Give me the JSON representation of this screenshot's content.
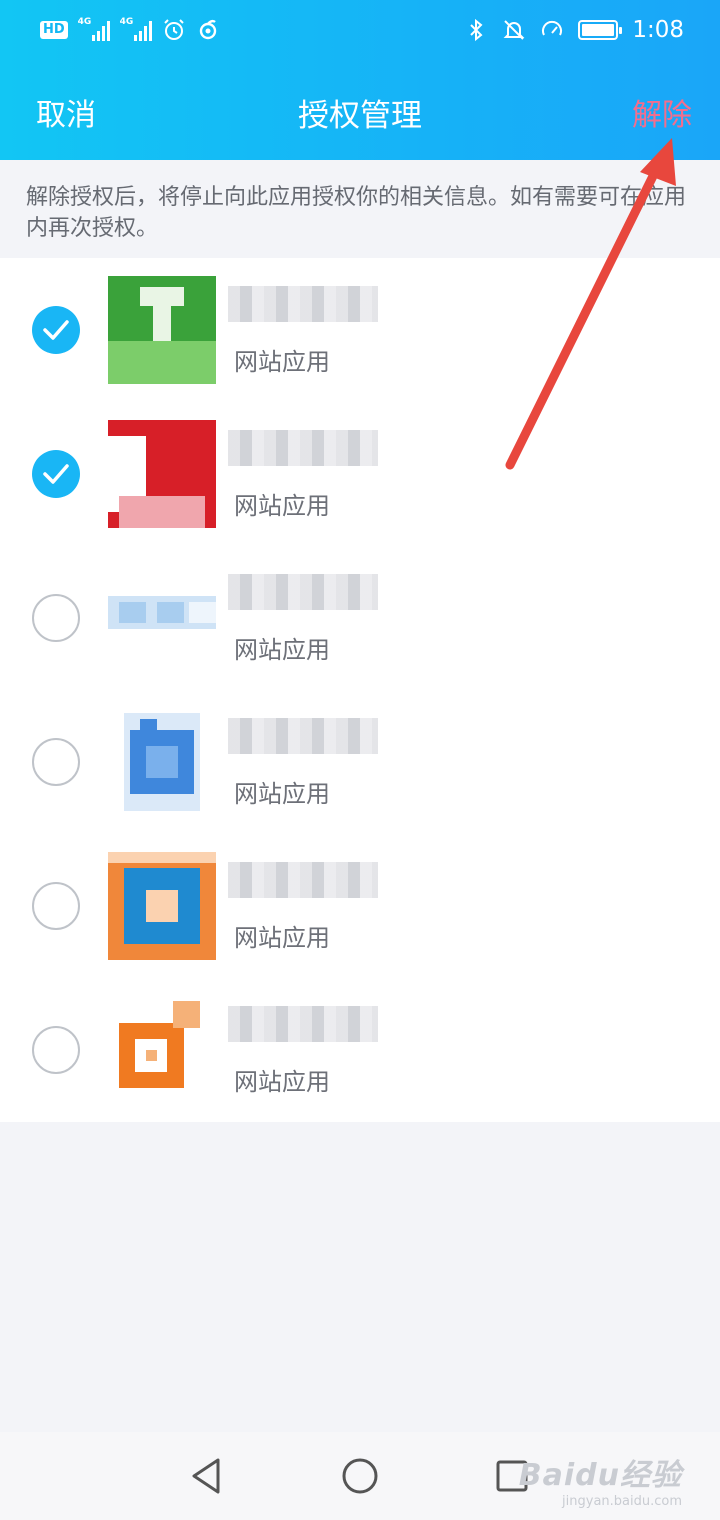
{
  "status_bar": {
    "hd_label": "HD",
    "network_label_1": "4G",
    "network_label_2": "4G",
    "time": "1:08"
  },
  "nav": {
    "cancel_label": "取消",
    "title": "授权管理",
    "remove_label": "解除",
    "remove_color": "#f26e8e"
  },
  "notice": "解除授权后，将停止向此应用授权你的相关信息。如有需要可在应用内再次授权。",
  "apps": [
    {
      "type": "网站应用",
      "checked": true,
      "icon": "green-t-app-icon",
      "colors": [
        "#3aa23a",
        "#7ccd6a",
        "#e9f5e5"
      ]
    },
    {
      "type": "网站应用",
      "checked": true,
      "icon": "red-app-icon",
      "colors": [
        "#d71f28",
        "#f0a6ad",
        "#ffffff"
      ]
    },
    {
      "type": "网站应用",
      "checked": false,
      "icon": "light-blue-app-icon",
      "colors": [
        "#cfe3f6",
        "#a8cdef",
        "#eef5fc"
      ]
    },
    {
      "type": "网站应用",
      "checked": false,
      "icon": "blue-paw-app-icon",
      "colors": [
        "#3f87dc",
        "#7ab0ec",
        "#dbe9f8"
      ]
    },
    {
      "type": "网站应用",
      "checked": false,
      "icon": "orange-blue-app-icon",
      "colors": [
        "#f0873a",
        "#1f8ad0",
        "#fbd2b0"
      ]
    },
    {
      "type": "网站应用",
      "checked": false,
      "icon": "orange-circle-app-icon",
      "colors": [
        "#f07a21",
        "#f5b178",
        "#ffffff"
      ]
    }
  ],
  "system_nav": [
    "back-icon",
    "home-icon",
    "recents-icon"
  ],
  "watermark": {
    "main": "Baidu经验",
    "sub": "jingyan.baidu.com"
  },
  "accent_color": "#19b6f5",
  "annotation_arrow_color": "#e8473d"
}
